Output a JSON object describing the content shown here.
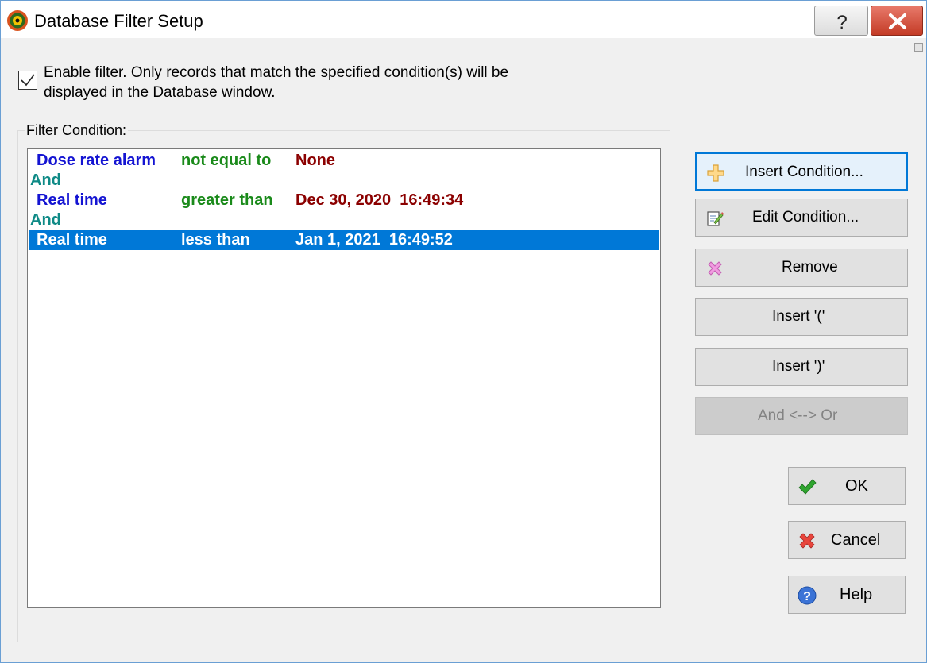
{
  "window": {
    "title": "Database Filter Setup"
  },
  "filter": {
    "enabled": true,
    "enable_label_line1": "Enable filter. Only records that match the specified condition(s) will be",
    "enable_label_line2": "displayed in the Database window.",
    "group_label": "Filter Condition:"
  },
  "conditions": [
    {
      "field": "Dose rate alarm",
      "operator": "not equal to",
      "value": "None"
    },
    {
      "conjunction": "And"
    },
    {
      "field": "Real time",
      "operator": "greater than",
      "value": "Dec 30, 2020  16:49:34"
    },
    {
      "conjunction": "And"
    },
    {
      "field": "Real time",
      "operator": "less than",
      "value": "Jan 1, 2021  16:49:52",
      "selected": true
    }
  ],
  "actions": {
    "insert_condition": "Insert Condition...",
    "edit_condition": "Edit Condition...",
    "remove": "Remove",
    "insert_open_paren": "Insert '('",
    "insert_close_paren": "Insert ')'",
    "and_or": "And <--> Or"
  },
  "dialog_buttons": {
    "ok": "OK",
    "cancel": "Cancel",
    "help": "Help"
  },
  "colors": {
    "field": "#1414d2",
    "operator": "#1a8a1a",
    "value": "#8b0000",
    "conjunction": "#0e8a86",
    "selection": "#0078d7"
  }
}
